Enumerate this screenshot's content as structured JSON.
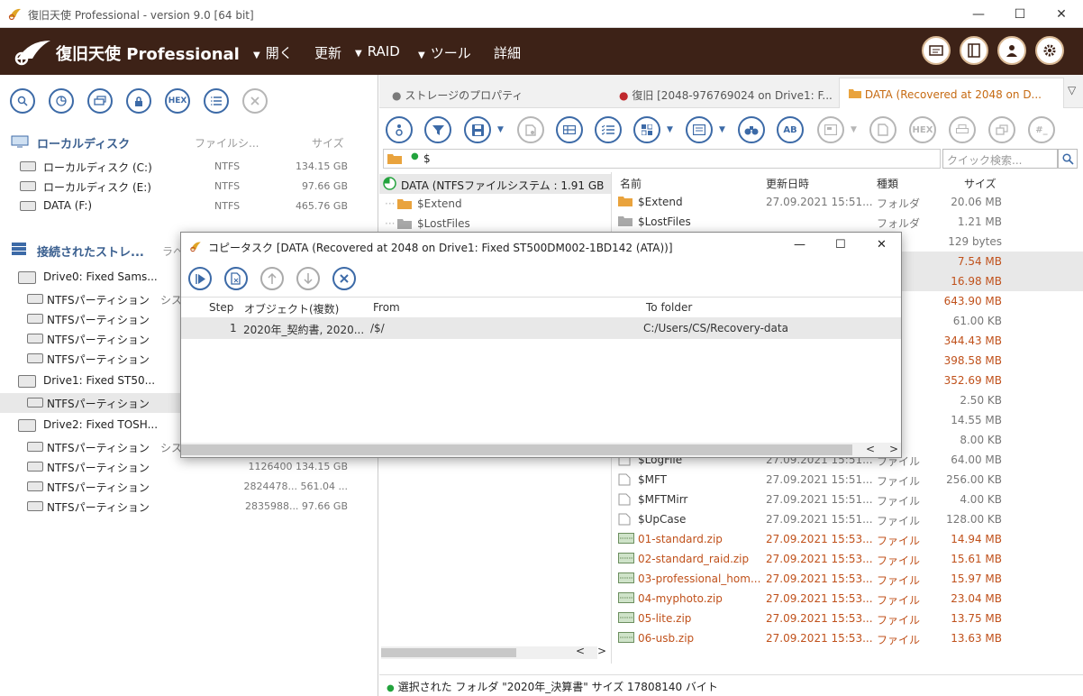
{
  "window": {
    "title": "復旧天使 Professional - version 9.0 [64 bit]",
    "min": "—",
    "max": "☐",
    "close": "✕"
  },
  "ribbon": {
    "brand": "復旧天使 Professional",
    "menu": [
      {
        "label": "開く",
        "arrow": "▼"
      },
      {
        "label": "更新",
        "arrow": ""
      },
      {
        "label": "RAID",
        "arrow": "▼"
      },
      {
        "label": "ツール",
        "arrow": "▼"
      },
      {
        "label": "詳細",
        "arrow": ""
      }
    ]
  },
  "left": {
    "toolbar": {
      "hex": "HEX"
    },
    "local_section": "ローカルディスク",
    "col_fs": "ファイルシ...",
    "col_size": "サイズ",
    "local_disks": [
      {
        "name": "ローカルディスク (C:)",
        "fs": "NTFS",
        "size": "134.15 GB"
      },
      {
        "name": "ローカルディスク (E:)",
        "fs": "NTFS",
        "size": "97.66 GB"
      },
      {
        "name": "DATA (F:)",
        "fs": "NTFS",
        "size": "465.76 GB"
      }
    ],
    "storage_section": "接続されたストレ...",
    "col_label": "ラベ",
    "drives": [
      {
        "name": "Drive0: Fixed Sams...",
        "partitions": [
          {
            "name": "NTFSパーティション",
            "extra": "シス",
            "size": ""
          },
          {
            "name": "NTFSパーティション",
            "extra": "",
            "size": ""
          },
          {
            "name": "NTFSパーティション",
            "extra": "",
            "size": ""
          },
          {
            "name": "NTFSパーティション",
            "extra": "",
            "size": ""
          }
        ]
      },
      {
        "name": "Drive1: Fixed ST50...",
        "partitions": [
          {
            "name": "NTFSパーティション",
            "extra": "",
            "size": ""
          }
        ]
      },
      {
        "name": "Drive2: Fixed TOSH...",
        "partitions": [
          {
            "name": "NTFSパーティション",
            "extra": "シス",
            "size": ""
          },
          {
            "name": "NTFSパーティション",
            "extra": "",
            "size": "1126400 134.15 GB"
          },
          {
            "name": "NTFSパーティション",
            "extra": "",
            "size": "2824478... 561.04 ..."
          },
          {
            "name": "NTFSパーティション",
            "extra": "",
            "size": "2835988... 97.66 GB"
          }
        ]
      }
    ]
  },
  "right": {
    "tabs": [
      {
        "label": "ストレージのプロパティ",
        "dot": "#7a7a7a"
      },
      {
        "label": "復旧 [2048-976769024 on Drive1: F...",
        "dot": "#c0282d"
      },
      {
        "label": "DATA (Recovered at 2048 on D...",
        "dot": ""
      }
    ],
    "tab_menu": "▽",
    "toolbar": {
      "ab": "AB",
      "hex": "HEX",
      "hash": "#_"
    },
    "path": "$",
    "search_placeholder": "クイック検索...",
    "tree": [
      {
        "label": "DATA (NTFSファイルシステム : 1.91 GB"
      },
      {
        "label": "$Extend"
      },
      {
        "label": "$LostFiles"
      }
    ],
    "columns": {
      "name": "名前",
      "date": "更新日時",
      "type": "種類",
      "size": "サイズ"
    },
    "files": [
      {
        "name": "$Extend",
        "date": "27.09.2021 15:51...",
        "type": "フォルダ",
        "size": "20.06 MB",
        "icon": "folder",
        "orange": false
      },
      {
        "name": "$LostFiles",
        "date": "",
        "type": "フォルダ",
        "size": "1.21 MB",
        "icon": "folder-gray",
        "orange": false
      },
      {
        "name": "",
        "date": "",
        "type": "ダ",
        "size": "129 bytes",
        "icon": "",
        "orange": false
      },
      {
        "name": "",
        "date": "",
        "type": "ダ",
        "size": "7.54 MB",
        "icon": "",
        "orange": true
      },
      {
        "name": "",
        "date": "",
        "type": "ダ",
        "size": "16.98 MB",
        "icon": "",
        "orange": true
      },
      {
        "name": "",
        "date": "",
        "type": "ダ",
        "size": "643.90 MB",
        "icon": "",
        "orange": true
      },
      {
        "name": "",
        "date": "",
        "type": "ダ",
        "size": "61.00 KB",
        "icon": "",
        "orange": false
      },
      {
        "name": "",
        "date": "",
        "type": "ダ",
        "size": "344.43 MB",
        "icon": "",
        "orange": true
      },
      {
        "name": "",
        "date": "",
        "type": "ダ",
        "size": "398.58 MB",
        "icon": "",
        "orange": true
      },
      {
        "name": "",
        "date": "",
        "type": "ダ",
        "size": "352.69 MB",
        "icon": "",
        "orange": true
      },
      {
        "name": "",
        "date": "",
        "type": "イル",
        "size": "2.50 KB",
        "icon": "",
        "orange": false
      },
      {
        "name": "",
        "date": "",
        "type": "イル",
        "size": "14.55 MB",
        "icon": "",
        "orange": false
      },
      {
        "name": "",
        "date": "",
        "type": "イル",
        "size": "8.00 KB",
        "icon": "",
        "orange": false
      },
      {
        "name": "$LogFile",
        "date": "27.09.2021 15:51...",
        "type": "ファイル",
        "size": "64.00 MB",
        "icon": "file",
        "orange": false
      },
      {
        "name": "$MFT",
        "date": "27.09.2021 15:51...",
        "type": "ファイル",
        "size": "256.00 KB",
        "icon": "file",
        "orange": false
      },
      {
        "name": "$MFTMirr",
        "date": "27.09.2021 15:51...",
        "type": "ファイル",
        "size": "4.00 KB",
        "icon": "file",
        "orange": false
      },
      {
        "name": "$UpCase",
        "date": "27.09.2021 15:51...",
        "type": "ファイル",
        "size": "128.00 KB",
        "icon": "file",
        "orange": false
      },
      {
        "name": "01-standard.zip",
        "date": "27.09.2021 15:53...",
        "type": "ファイル",
        "size": "14.94 MB",
        "icon": "zip",
        "orange": true
      },
      {
        "name": "02-standard_raid.zip",
        "date": "27.09.2021 15:53...",
        "type": "ファイル",
        "size": "15.61 MB",
        "icon": "zip",
        "orange": true
      },
      {
        "name": "03-professional_hom...",
        "date": "27.09.2021 15:53...",
        "type": "ファイル",
        "size": "15.97 MB",
        "icon": "zip",
        "orange": true
      },
      {
        "name": "04-myphoto.zip",
        "date": "27.09.2021 15:53...",
        "type": "ファイル",
        "size": "23.04 MB",
        "icon": "zip",
        "orange": true
      },
      {
        "name": "05-lite.zip",
        "date": "27.09.2021 15:53...",
        "type": "ファイル",
        "size": "13.75 MB",
        "icon": "zip",
        "orange": true
      },
      {
        "name": "06-usb.zip",
        "date": "27.09.2021 15:53...",
        "type": "ファイル",
        "size": "13.63 MB",
        "icon": "zip",
        "orange": true
      }
    ],
    "status": "選択された フォルダ \"2020年_決算書\" サイズ 17808140 バイト"
  },
  "dialog": {
    "title": "コピータスク [DATA (Recovered at 2048 on Drive1: Fixed ST500DM002-1BD142 (ATA))]",
    "columns": {
      "step": "Step",
      "objects": "オブジェクト(複数)",
      "from": "From",
      "to": "To folder"
    },
    "rows": [
      {
        "step": "1",
        "objects": "2020年_契約書, 2020...",
        "from": "/$/",
        "to": "C:/Users/CS/Recovery-data"
      }
    ],
    "scroll_left": "<",
    "scroll_right": ">"
  }
}
